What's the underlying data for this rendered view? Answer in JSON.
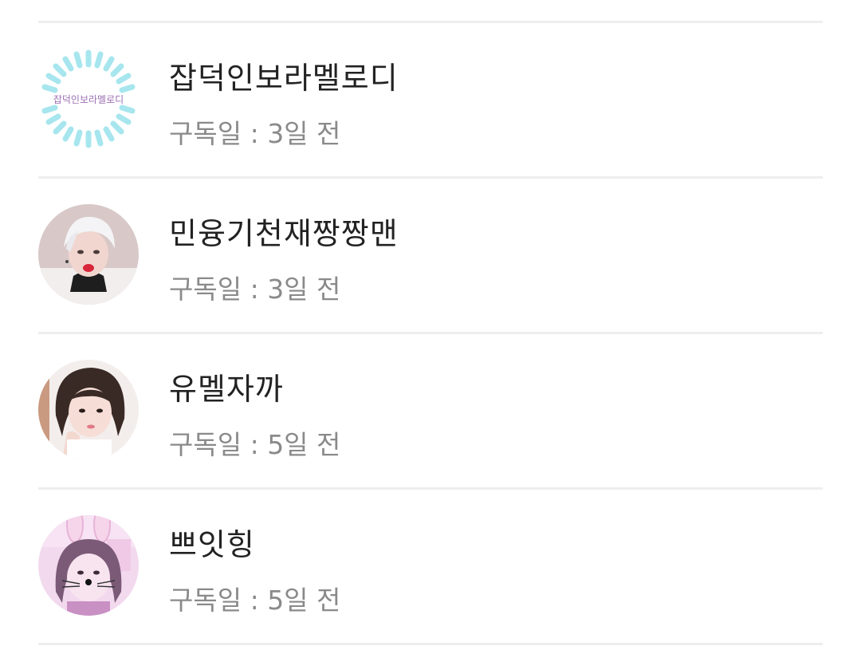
{
  "subscribers": [
    {
      "name": "잡덕인보라멜로디",
      "meta_label": "구독일 : ",
      "days": "3일 전",
      "avatar": "sunburst-logo-avatar",
      "avatar_text": "잡덕인보라멜로디"
    },
    {
      "name": "민융기천재짱짱맨",
      "meta_label": "구독일 : ",
      "days": "3일 전",
      "avatar": "white-hair-person-avatar"
    },
    {
      "name": "유멜자까",
      "meta_label": "구독일 : ",
      "days": "5일 전",
      "avatar": "bob-hair-girl-avatar"
    },
    {
      "name": "쁘잇힝",
      "meta_label": "구독일 : ",
      "days": "5일 전",
      "avatar": "bunny-filter-girl-avatar"
    }
  ],
  "colors": {
    "name": "#222222",
    "meta": "#8a8a8a",
    "divider": "#eeeeee",
    "sunburst": "#a7e6ee"
  }
}
